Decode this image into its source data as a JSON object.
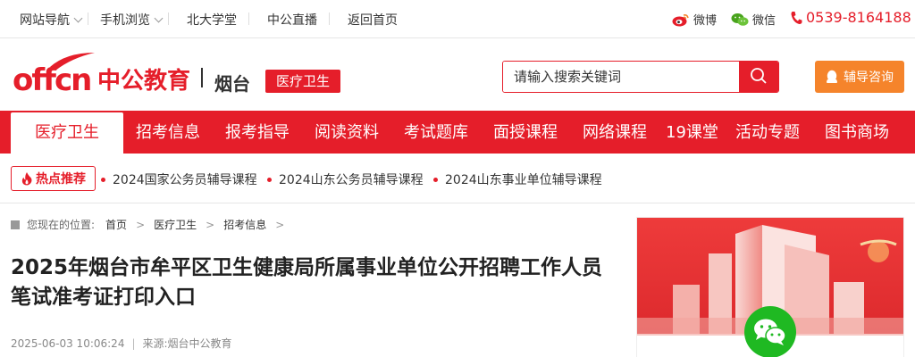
{
  "topbar": {
    "site_nav": "网站导航",
    "mobile": "手机浏览",
    "pku": "北大学堂",
    "live": "中公直播",
    "home": "返回首页",
    "weibo": "微博",
    "wechat": "微信",
    "phone": "0539-8164188"
  },
  "header": {
    "logo_en": "offcn",
    "logo_cn": "中公教育",
    "city": "烟台",
    "channel_tag": "医疗卫生",
    "search_placeholder": "请输入搜索关键词",
    "consult": "辅导咨询"
  },
  "nav": {
    "items": [
      {
        "label": "医疗卫生"
      },
      {
        "label": "招考信息"
      },
      {
        "label": "报考指导"
      },
      {
        "label": "阅读资料"
      },
      {
        "label": "考试题库"
      },
      {
        "label": "面授课程"
      },
      {
        "label": "网络课程"
      },
      {
        "label": "19课堂"
      },
      {
        "label": "活动专题"
      },
      {
        "label": "图书商场"
      }
    ]
  },
  "hot": {
    "tag": "热点推荐",
    "links": [
      {
        "label": "2024国家公务员辅导课程"
      },
      {
        "label": "2024山东公务员辅导课程"
      },
      {
        "label": "2024山东事业单位辅导课程"
      }
    ]
  },
  "breadcrumb": {
    "prefix": "您现在的位置:",
    "items": [
      {
        "label": "首页"
      },
      {
        "label": "医疗卫生"
      },
      {
        "label": "招考信息"
      }
    ],
    "trail": ">"
  },
  "article": {
    "title": "2025年烟台市牟平区卫生健康局所属事业单位公开招聘工作人员笔试准考证打印入口",
    "datetime": "2025-06-03 10:06:24",
    "source": "来源:烟台中公教育"
  },
  "colors": {
    "brand_red": "#e51e2a",
    "consult_orange": "#f5842b",
    "wechat_green": "#1fb922"
  },
  "icons": [
    "chevron-down-icon",
    "weibo-icon",
    "wechat-icon",
    "phone-icon",
    "search-icon",
    "qq-icon",
    "flame-icon",
    "home-icon"
  ]
}
